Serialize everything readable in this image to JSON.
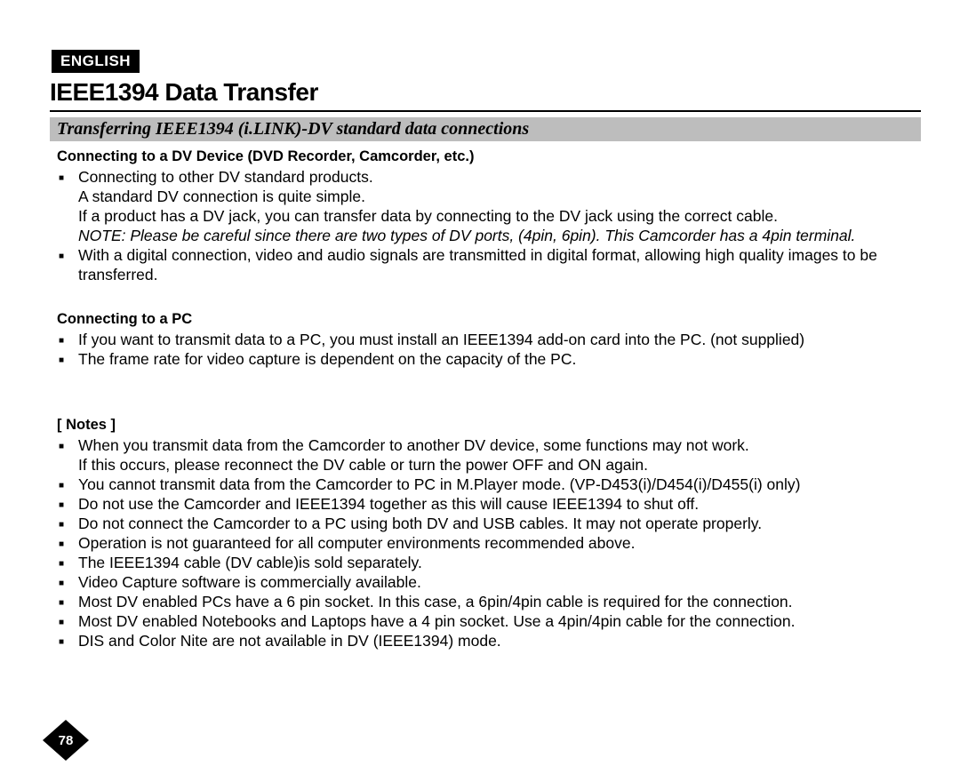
{
  "language_badge": "ENGLISH",
  "title": "IEEE1394 Data Transfer",
  "subtitle": "Transferring IEEE1394 (i.LINK)-DV standard data connections",
  "section1": {
    "heading": "Connecting to a DV Device (DVD Recorder, Camcorder, etc.)",
    "items": [
      {
        "lines": [
          "Connecting to other DV standard products.",
          "A standard DV connection is quite simple.",
          "If a product has a DV jack, you can transfer data by connecting to the DV jack using the correct cable."
        ],
        "note": "NOTE: Please be careful since there are two types of DV ports, (4pin, 6pin). This Camcorder has a 4pin terminal."
      },
      {
        "lines": [
          "With a digital connection, video and audio signals are transmitted in digital format, allowing high quality images to be transferred."
        ]
      }
    ]
  },
  "section2": {
    "heading": "Connecting to a PC",
    "items": [
      "If you want to transmit data to a PC, you must install an IEEE1394 add-on card into the PC. (not supplied)",
      "The frame rate for video capture is dependent on the capacity of the PC."
    ]
  },
  "notes": {
    "heading": "[ Notes ]",
    "items": [
      "When you transmit data from the Camcorder to another DV device, some functions may not work.\nIf this occurs, please reconnect the DV cable or turn the power OFF and ON again.",
      "You cannot transmit data from the Camcorder to PC in M.Player mode. (VP-D453(i)/D454(i)/D455(i) only)",
      "Do not use the Camcorder and IEEE1394 together as this will cause IEEE1394 to shut off.",
      "Do not connect the Camcorder to a PC using both DV and USB cables. It may not operate properly.",
      "Operation is not guaranteed for all computer environments recommended above.",
      "The IEEE1394 cable (DV cable)is sold separately.",
      "Video Capture software is commercially available.",
      "Most DV enabled PCs have a 6 pin socket. In this case, a 6pin/4pin cable is required for the connection.",
      "Most DV enabled Notebooks and Laptops have a 4 pin socket. Use a 4pin/4pin cable for the connection.",
      "DIS and Color Nite are not available in DV (IEEE1394) mode."
    ]
  },
  "page_number": "78"
}
